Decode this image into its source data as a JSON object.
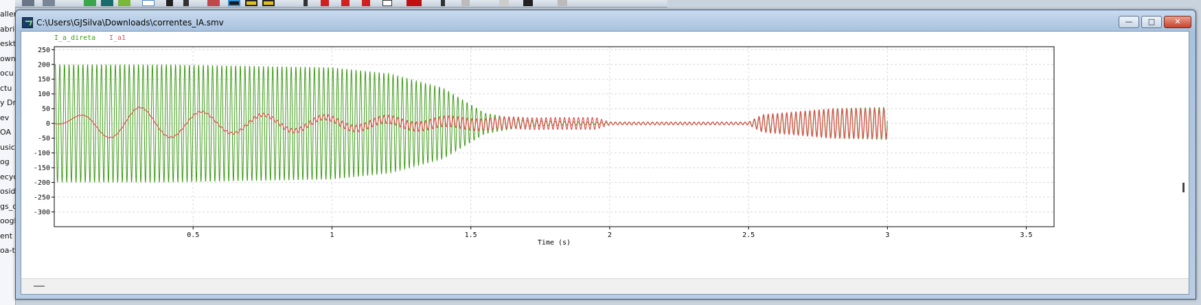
{
  "desktop": {
    "items": [
      "aller",
      "abrie",
      "eskto",
      "own",
      "ocu",
      "ctu",
      "y Dr",
      "ev",
      "OA",
      "usic",
      "og",
      "ecyc",
      "osid",
      "gs_c",
      "oogl",
      "ent",
      "oa-t"
    ]
  },
  "window": {
    "title": "C:\\Users\\GJSilva\\Downloads\\correntes_IA.smv",
    "minimize_label": "—",
    "maximize_label": "□",
    "close_label": "✕"
  },
  "chart_data": {
    "type": "line",
    "title": "",
    "xlabel": "Time (s)",
    "ylabel": "",
    "xlim": [
      0,
      3.6
    ],
    "ylim": [
      -350,
      260
    ],
    "x_ticks": [
      0.5,
      1,
      1.5,
      2,
      2.5,
      3,
      3.5
    ],
    "y_ticks": [
      250,
      200,
      150,
      100,
      50,
      0,
      -50,
      -100,
      -150,
      -200,
      -250,
      -300
    ],
    "grid": true,
    "legend_position": "top-left",
    "series": [
      {
        "name": "I_a_direta",
        "color": "#3a9a12",
        "frequency_hz": 60,
        "envelope": [
          {
            "t": 0.0,
            "amp": 200
          },
          {
            "t": 0.4,
            "amp": 200
          },
          {
            "t": 1.0,
            "amp": 190
          },
          {
            "t": 1.2,
            "amp": 170
          },
          {
            "t": 1.4,
            "amp": 120
          },
          {
            "t": 1.55,
            "amp": 35
          },
          {
            "t": 1.7,
            "amp": 10
          },
          {
            "t": 1.95,
            "amp": 4
          },
          {
            "t": 2.5,
            "amp": 4
          },
          {
            "t": 2.55,
            "amp": 25
          },
          {
            "t": 2.8,
            "amp": 50
          },
          {
            "t": 3.0,
            "amp": 55
          }
        ]
      },
      {
        "name": "I_a1",
        "color": "#e05050",
        "low_freq_hz": 4.5,
        "low_freq_envelope": [
          {
            "t": 0.0,
            "amp": 0
          },
          {
            "t": 0.15,
            "amp": 45
          },
          {
            "t": 0.3,
            "amp": 55
          },
          {
            "t": 0.6,
            "amp": 35
          },
          {
            "t": 1.0,
            "amp": 20
          },
          {
            "t": 1.5,
            "amp": 5
          },
          {
            "t": 1.8,
            "amp": 0
          }
        ],
        "high_freq_hz": 60,
        "high_freq_envelope": [
          {
            "t": 0.0,
            "amp": 0
          },
          {
            "t": 0.6,
            "amp": 3
          },
          {
            "t": 1.0,
            "amp": 10
          },
          {
            "t": 1.5,
            "amp": 20
          },
          {
            "t": 1.95,
            "amp": 20
          },
          {
            "t": 2.0,
            "amp": 5
          },
          {
            "t": 2.5,
            "amp": 5
          },
          {
            "t": 2.55,
            "amp": 30
          },
          {
            "t": 2.8,
            "amp": 50
          },
          {
            "t": 3.0,
            "amp": 50
          }
        ]
      }
    ]
  }
}
